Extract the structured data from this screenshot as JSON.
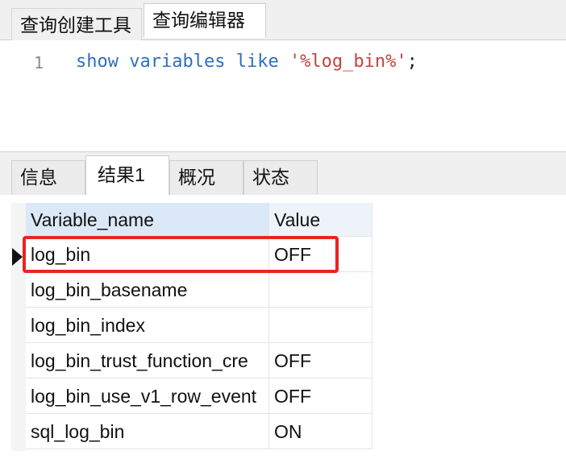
{
  "top_tabs": [
    "查询创建工具",
    "查询编辑器"
  ],
  "editor": {
    "line_number": "1",
    "keyword1": "show",
    "keyword2": "variables",
    "keyword3": "like",
    "string": "'%log_bin%'",
    "terminator": ";"
  },
  "result_tabs": [
    "信息",
    "结果1",
    "概况",
    "状态"
  ],
  "table": {
    "columns": [
      "Variable_name",
      "Value"
    ],
    "rows": [
      [
        "log_bin",
        "OFF"
      ],
      [
        "log_bin_basename",
        ""
      ],
      [
        "log_bin_index",
        ""
      ],
      [
        "log_bin_trust_function_cre",
        "OFF"
      ],
      [
        "log_bin_use_v1_row_event",
        "OFF"
      ],
      [
        "sql_log_bin",
        "ON"
      ]
    ]
  },
  "colors": {
    "highlight": "#e8251f",
    "keyword": "#2f6fbf",
    "string": "#c2453d",
    "header_bg": "#dbe8f7"
  }
}
